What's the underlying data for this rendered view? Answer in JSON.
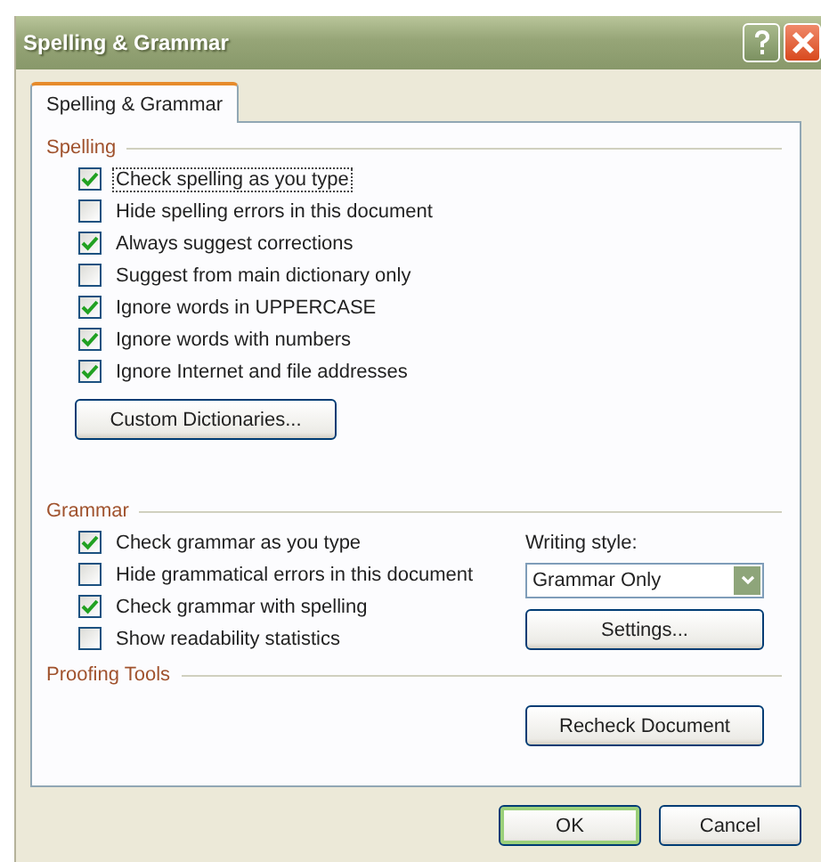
{
  "window": {
    "title": "Spelling & Grammar"
  },
  "tabs": [
    {
      "label": "Spelling & Grammar",
      "selected": true
    }
  ],
  "spelling": {
    "heading": "Spelling",
    "options": [
      {
        "label": "Check spelling as you type",
        "checked": true,
        "focused": true
      },
      {
        "label": "Hide spelling errors in this document",
        "checked": false,
        "focused": false
      },
      {
        "label": "Always suggest corrections",
        "checked": true,
        "focused": false
      },
      {
        "label": "Suggest from main dictionary only",
        "checked": false,
        "focused": false
      },
      {
        "label": "Ignore words in UPPERCASE",
        "checked": true,
        "focused": false
      },
      {
        "label": "Ignore words with numbers",
        "checked": true,
        "focused": false
      },
      {
        "label": "Ignore Internet and file addresses",
        "checked": true,
        "focused": false
      }
    ],
    "button": {
      "label": "Custom Dictionaries..."
    }
  },
  "grammar": {
    "heading": "Grammar",
    "options": [
      {
        "label": "Check grammar as you type",
        "checked": true
      },
      {
        "label": "Hide grammatical errors in this document",
        "checked": false
      },
      {
        "label": "Check grammar with spelling",
        "checked": true
      },
      {
        "label": "Show readability statistics",
        "checked": false
      }
    ],
    "writing_style": {
      "label": "Writing style:",
      "value": "Grammar Only"
    },
    "button": {
      "label": "Settings..."
    }
  },
  "proofing_tools": {
    "heading": "Proofing Tools",
    "button": {
      "label": "Recheck Document"
    }
  },
  "buttons": [
    {
      "label": "OK",
      "default": true
    },
    {
      "label": "Cancel",
      "default": false
    }
  ]
}
